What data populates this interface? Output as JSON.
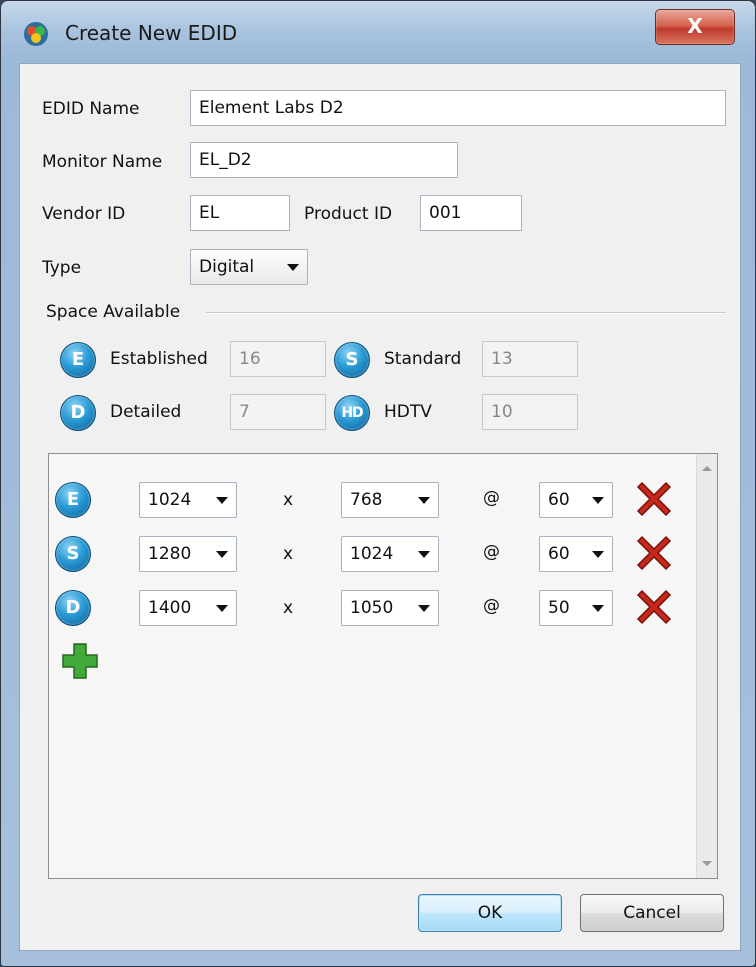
{
  "window": {
    "title": "Create New EDID",
    "close_glyph": "X"
  },
  "form": {
    "edid_name_label": "EDID Name",
    "edid_name_value": "Element Labs D2",
    "monitor_name_label": "Monitor Name",
    "monitor_name_value": "EL_D2",
    "vendor_id_label": "Vendor ID",
    "vendor_id_value": "EL",
    "product_id_label": "Product ID",
    "product_id_value": "001",
    "type_label": "Type",
    "type_value": "Digital"
  },
  "space": {
    "group_label": "Space Available",
    "established_badge": "E",
    "established_label": "Established",
    "established_value": "16",
    "standard_badge": "S",
    "standard_label": "Standard",
    "standard_value": "13",
    "detailed_badge": "D",
    "detailed_label": "Detailed",
    "detailed_value": "7",
    "hdtv_badge": "HD",
    "hdtv_label": "HDTV",
    "hdtv_value": "10"
  },
  "timings": [
    {
      "badge": "E",
      "width": "1024",
      "times": "x",
      "height": "768",
      "at": "@",
      "rate": "60"
    },
    {
      "badge": "S",
      "width": "1280",
      "times": "x",
      "height": "1024",
      "at": "@",
      "rate": "60"
    },
    {
      "badge": "D",
      "width": "1400",
      "times": "x",
      "height": "1050",
      "at": "@",
      "rate": "50"
    }
  ],
  "buttons": {
    "ok": "OK",
    "cancel": "Cancel"
  },
  "colors": {
    "badge_blue": "#2a9ad6",
    "delete_red": "#c8281c",
    "add_green": "#43a83a",
    "title_gradient": "#a9c3de"
  },
  "icons": {
    "app": "app-icon",
    "close": "close-icon",
    "delete": "delete-x-icon",
    "add": "plus-icon"
  }
}
